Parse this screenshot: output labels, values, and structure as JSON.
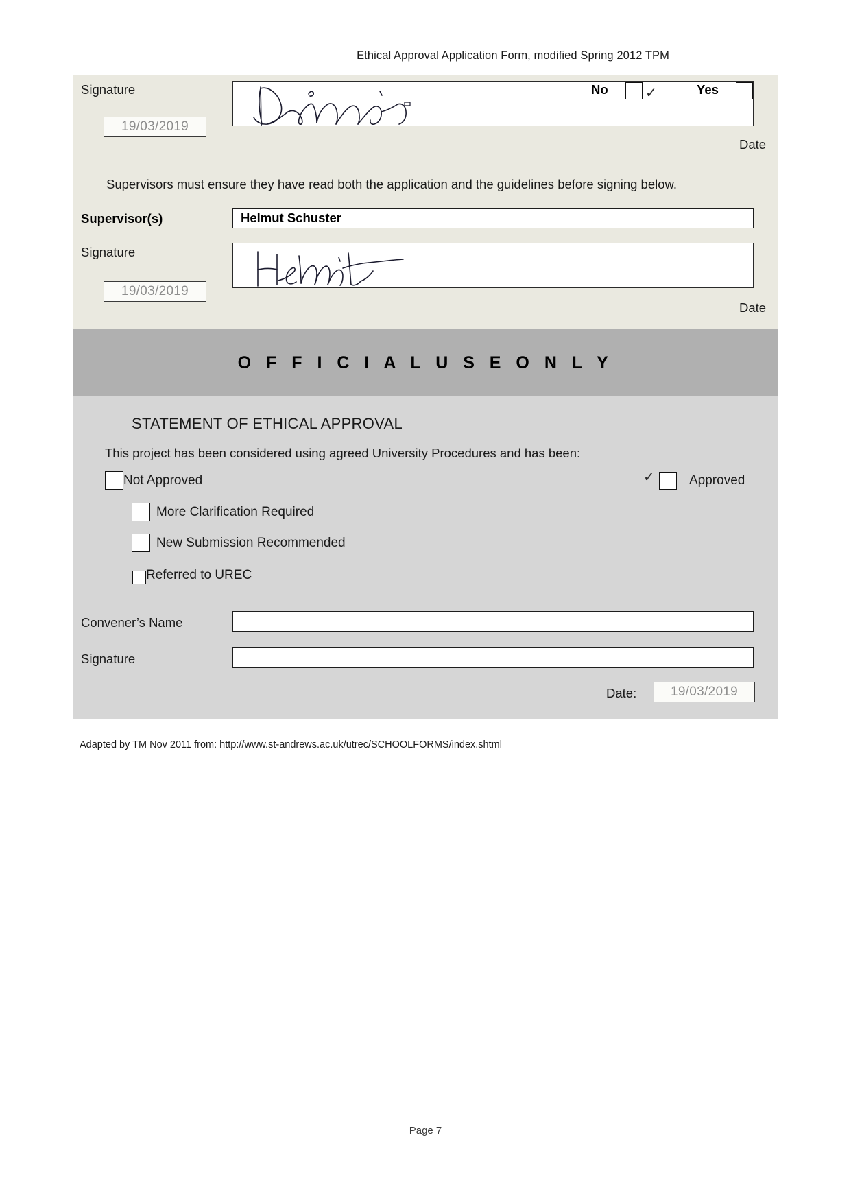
{
  "document": {
    "header": "Ethical Approval Application Form, modified Spring 2012  TPM",
    "footer_page": "Page 7",
    "adapted_note": "Adapted by TM Nov 2011 from: http://www.st-andrews.ac.uk/utrec/SCHOOLFORMS/index.shtml"
  },
  "applicant_section": {
    "signature_label": "Signature",
    "signature_date": "19/03/2019",
    "date_label": "Date",
    "signature_value": "Divine",
    "no_label": "No",
    "no_checked_mark": "✓",
    "yes_label": "Yes",
    "yes_checked_mark": ""
  },
  "supervisor_section": {
    "instruction": "Supervisors must ensure they have read both the application and the guidelines before signing below.",
    "supervisors_label": "Supervisor(s)",
    "supervisors_value": "Helmut Schuster",
    "signature_label": "Signature",
    "signature_date": "19/03/2019",
    "date_label": "Date",
    "signature_value": "Helmut"
  },
  "official_use": {
    "banner": "O F F I C I A L   U S E   O N L Y",
    "statement_title": "STATEMENT OF ETHICAL APPROVAL",
    "statement_body": "This project has been considered using agreed University Procedures and has been:",
    "options": [
      {
        "label": "Not Approved",
        "checked": false
      },
      {
        "label": "More Clarification Required",
        "checked": false
      },
      {
        "label": "New Submission Recommended",
        "checked": false
      },
      {
        "label": "Referred to UREC",
        "checked": false
      }
    ],
    "approved_label": "Approved",
    "approved_mark": "✓",
    "convener_name_label": "Convener’s Name",
    "convener_name_value": "",
    "convener_signature_label": "Signature",
    "convener_signature_value": "",
    "date_label": "Date:",
    "date_value": "19/03/2019"
  },
  "colors": {
    "cream_band": "#eae9e0",
    "banner_gray": "#b0b0b0",
    "body_gray": "#d6d6d6",
    "page_white": "#ffffff",
    "placeholder_text": "#8d8d8d"
  }
}
